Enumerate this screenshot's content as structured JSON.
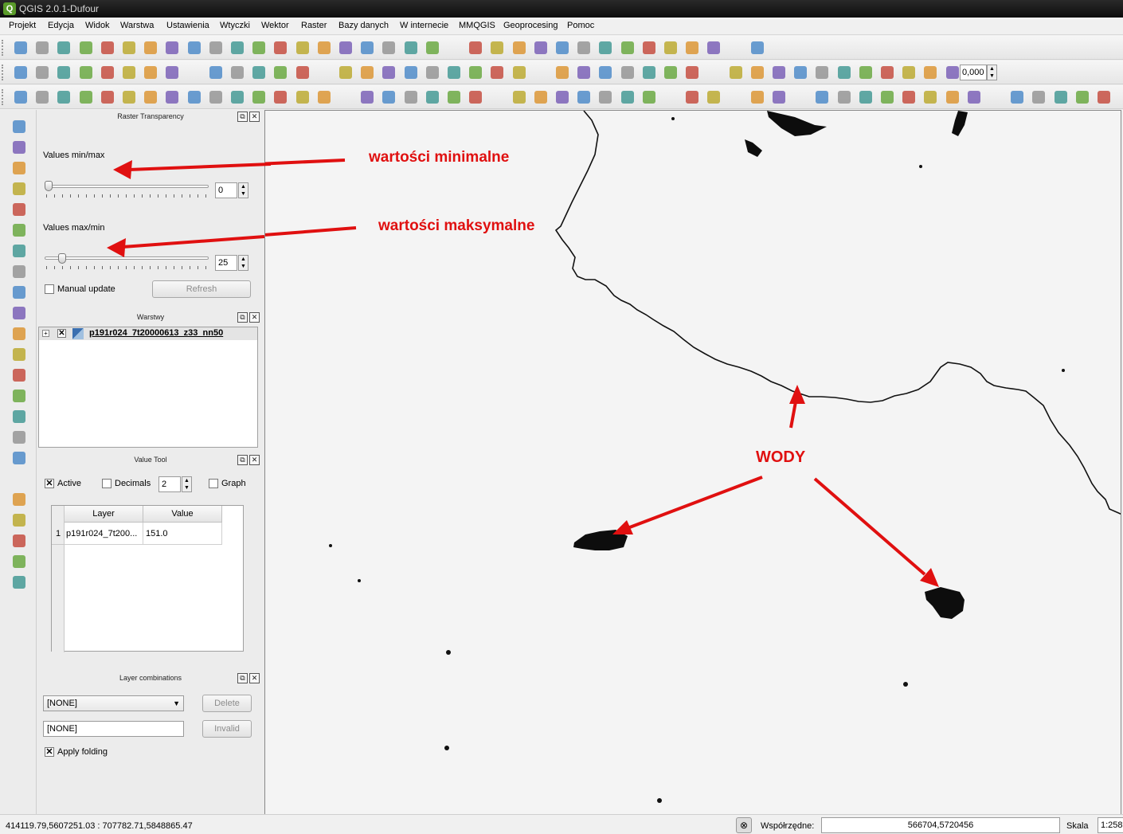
{
  "window": {
    "title": "QGIS 2.0.1-Dufour",
    "app_icon": "qgis-logo"
  },
  "menu": [
    "Projekt",
    "Edycja",
    "Widok",
    "Warstwa",
    "Ustawienia",
    "Wtyczki",
    "Wektor",
    "Raster",
    "Bazy danych",
    "W internecie",
    "MMQGIS",
    "Geoprocesing",
    "Pomoc"
  ],
  "toolbar": {
    "rotation_value": "0,000"
  },
  "raster_transparency": {
    "title": "Raster Transparency",
    "min_label": "Values min/max",
    "min_value": "0",
    "max_label": "Values max/min",
    "max_value": "25",
    "manual_update_label": "Manual update",
    "refresh_label": "Refresh"
  },
  "layers_panel": {
    "title": "Warstwy",
    "layer_name": "p191r024_7t20000613_z33_nn50"
  },
  "value_tool": {
    "title": "Value Tool",
    "active_label": "Active",
    "decimals_label": "Decimals",
    "decimals_value": "2",
    "graph_label": "Graph",
    "col_layer": "Layer",
    "col_value": "Value",
    "row_num": "1",
    "row_layer": "p191r024_7t200...",
    "row_value": "151.0"
  },
  "layer_combinations": {
    "title": "Layer combinations",
    "combo_value": "[NONE]",
    "delete_label": "Delete",
    "name_value": "[NONE]",
    "invalid_label": "Invalid",
    "apply_folding_label": "Apply folding"
  },
  "annotations": {
    "min_text": "wartości minimalne",
    "max_text": "wartości maksymalne",
    "water_text": "WODY",
    "color": "#e01010"
  },
  "statusbar": {
    "extent": "414119.79,5607251.03 : 707782.71,5848865.47",
    "coords_label": "Współrzędne:",
    "coords_value": "566704,5720456",
    "scale_label": "Skala",
    "scale_value": "1:258"
  }
}
